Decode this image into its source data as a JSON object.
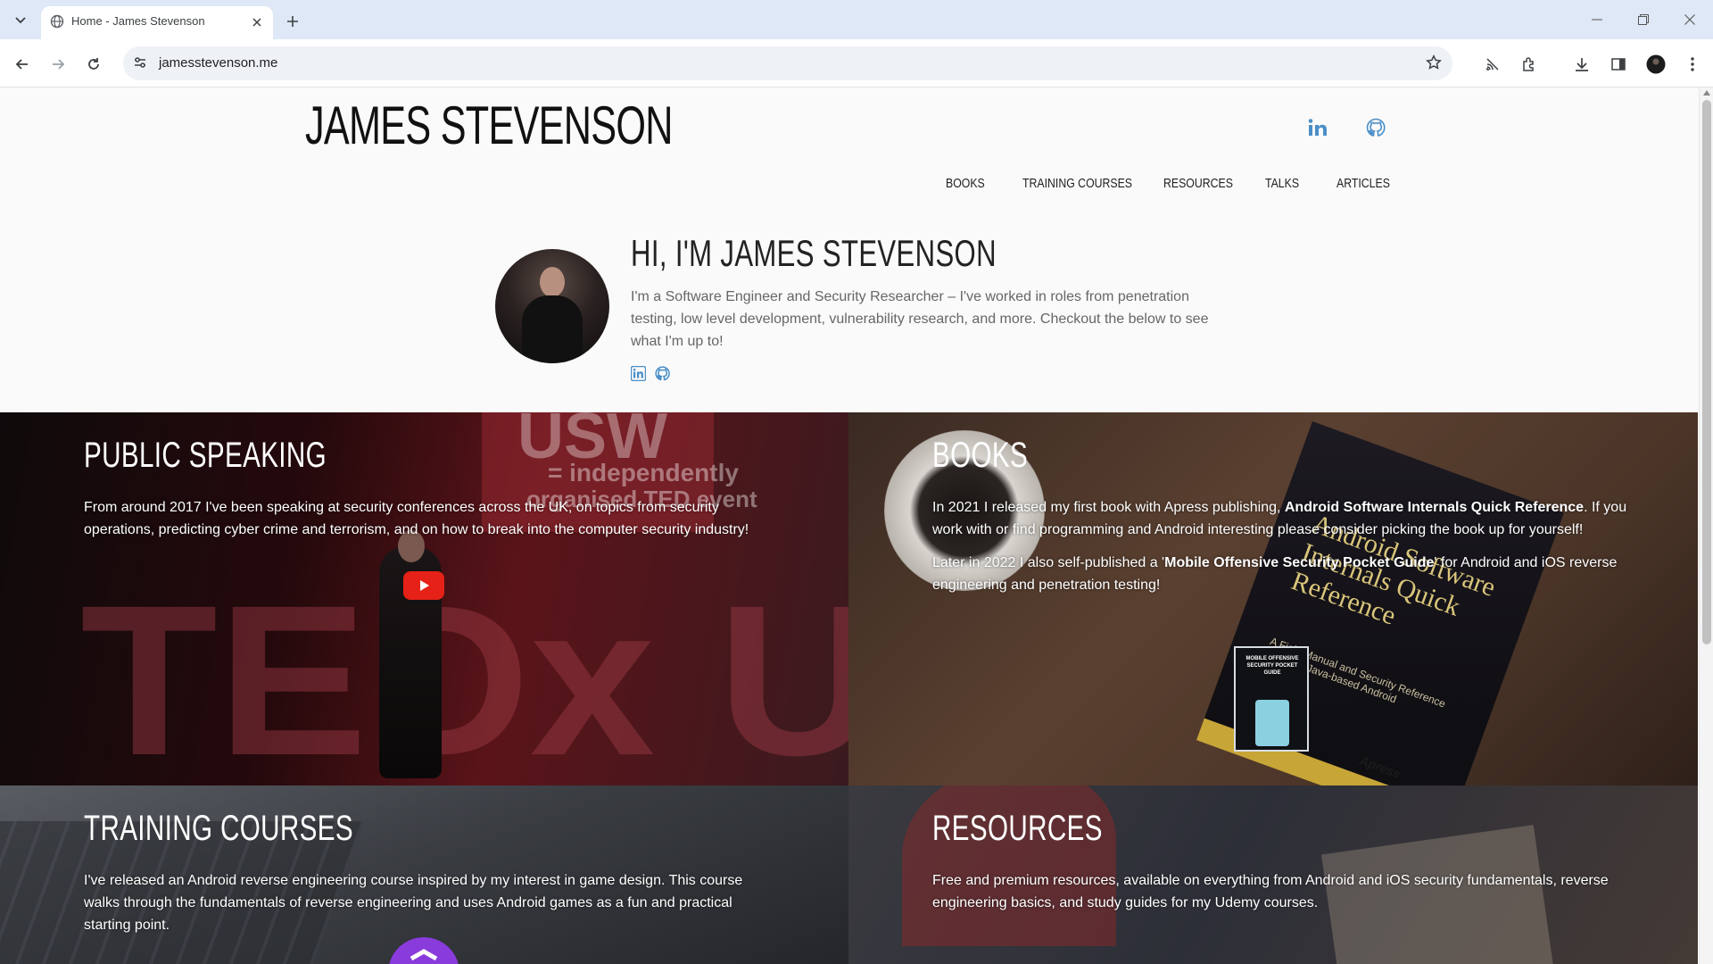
{
  "browser": {
    "tab_title": "Home - James Stevenson",
    "url": "jamesstevenson.me"
  },
  "site": {
    "title": "JAMES STEVENSON",
    "nav": [
      "BOOKS",
      "TRAINING COURSES",
      "RESOURCES",
      "TALKS",
      "ARTICLES"
    ]
  },
  "hero": {
    "title": "HI, I'M JAMES STEVENSON",
    "text": "I'm a Software Engineer and Security Researcher – I've worked in roles from penetration testing, low level development, vulnerability research, and more. Checkout the below to see what I'm up to!"
  },
  "tiles": {
    "speaking": {
      "title": "PUBLIC SPEAKING",
      "text": "From around 2017 I've been speaking at security conferences across the UK, on topics from security operations, predicting cyber crime and terrorism, and on how to break into the computer security industry!",
      "bg_text_top": "USW",
      "bg_text_sub1": "= independently",
      "bg_text_sub2": "organised TED event",
      "bg_text_bottom": "TEDx USW"
    },
    "books": {
      "title": "BOOKS",
      "p1_a": "In 2021 I released my first book with Apress publishing, ",
      "p1_b": "Android Software Internals Quick Reference",
      "p1_c": ". If you work with or find programming and Android interesting please consider picking the book up for yourself!",
      "p2_a": "Later in 2022 I also self-published a '",
      "p2_b": "Mobile Offensive Security Pocket Guide",
      "p2_c": "' for Android and iOS reverse engineering and penetration testing!",
      "book_cover_title": "Android Software Internals Quick Reference",
      "book_cover_sub": "A Field Manual and Security Reference Guide to Java-based Android",
      "book_publisher": "Apress",
      "pocket_cover": "MOBILE OFFENSIVE SECURITY POCKET GUIDE"
    },
    "training": {
      "title": "TRAINING COURSES",
      "text": "I've released an Android reverse engineering course inspired by my interest in game design. This course walks through the fundamentals of reverse engineering and uses Android games as a fun and practical starting point."
    },
    "resources": {
      "title": "RESOURCES",
      "text": "Free and premium resources, available on everything from Android and iOS security fundamentals, reverse engineering basics, and study guides for my Udemy courses."
    }
  },
  "colors": {
    "accent_social": "#4a8fc7",
    "youtube_red": "#e62117"
  },
  "icons": [
    "linkedin-icon",
    "github-icon",
    "youtube-play-icon"
  ]
}
